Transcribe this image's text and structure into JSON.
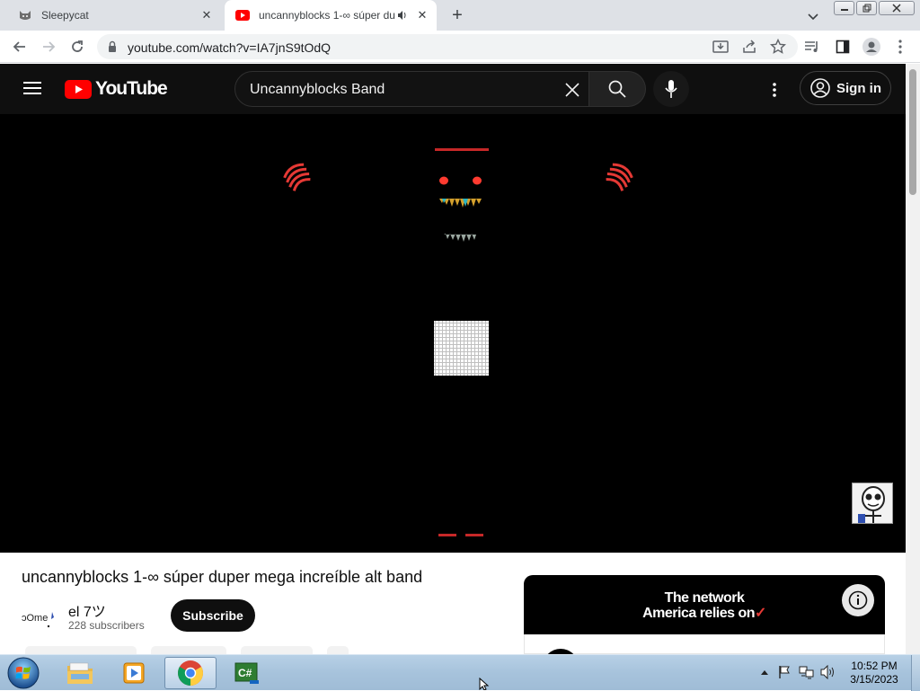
{
  "browser": {
    "tabs": [
      {
        "title": "Sleepycat",
        "icon": "cat-icon",
        "active": false
      },
      {
        "title": "uncannyblocks 1-∞ súper du",
        "icon": "youtube-favicon",
        "active": true,
        "audio": true
      }
    ],
    "url": "youtube.com/watch?v=IA7jnS9tOdQ"
  },
  "youtube": {
    "logo_text": "YouTube",
    "search_value": "Uncannyblocks Band",
    "signin_label": "Sign in",
    "video_title": "uncannyblocks 1-∞ súper duper mega increíble alt band",
    "channel": {
      "name": "el 7ツ",
      "subscribers": "228 subscribers",
      "avatar_text": "ɔOme"
    },
    "subscribe_label": "Subscribe",
    "ad": {
      "line1": "The network",
      "line2": "America relies on"
    }
  },
  "taskbar": {
    "apps": [
      "file-explorer-icon",
      "media-player-icon",
      "chrome-icon",
      "csharp-icon"
    ],
    "time": "10:52 PM",
    "date": "3/15/2023"
  },
  "colors": {
    "yt_red": "#ff0000",
    "yt_dark": "#0f0f0f",
    "accent_red": "#e53935"
  }
}
